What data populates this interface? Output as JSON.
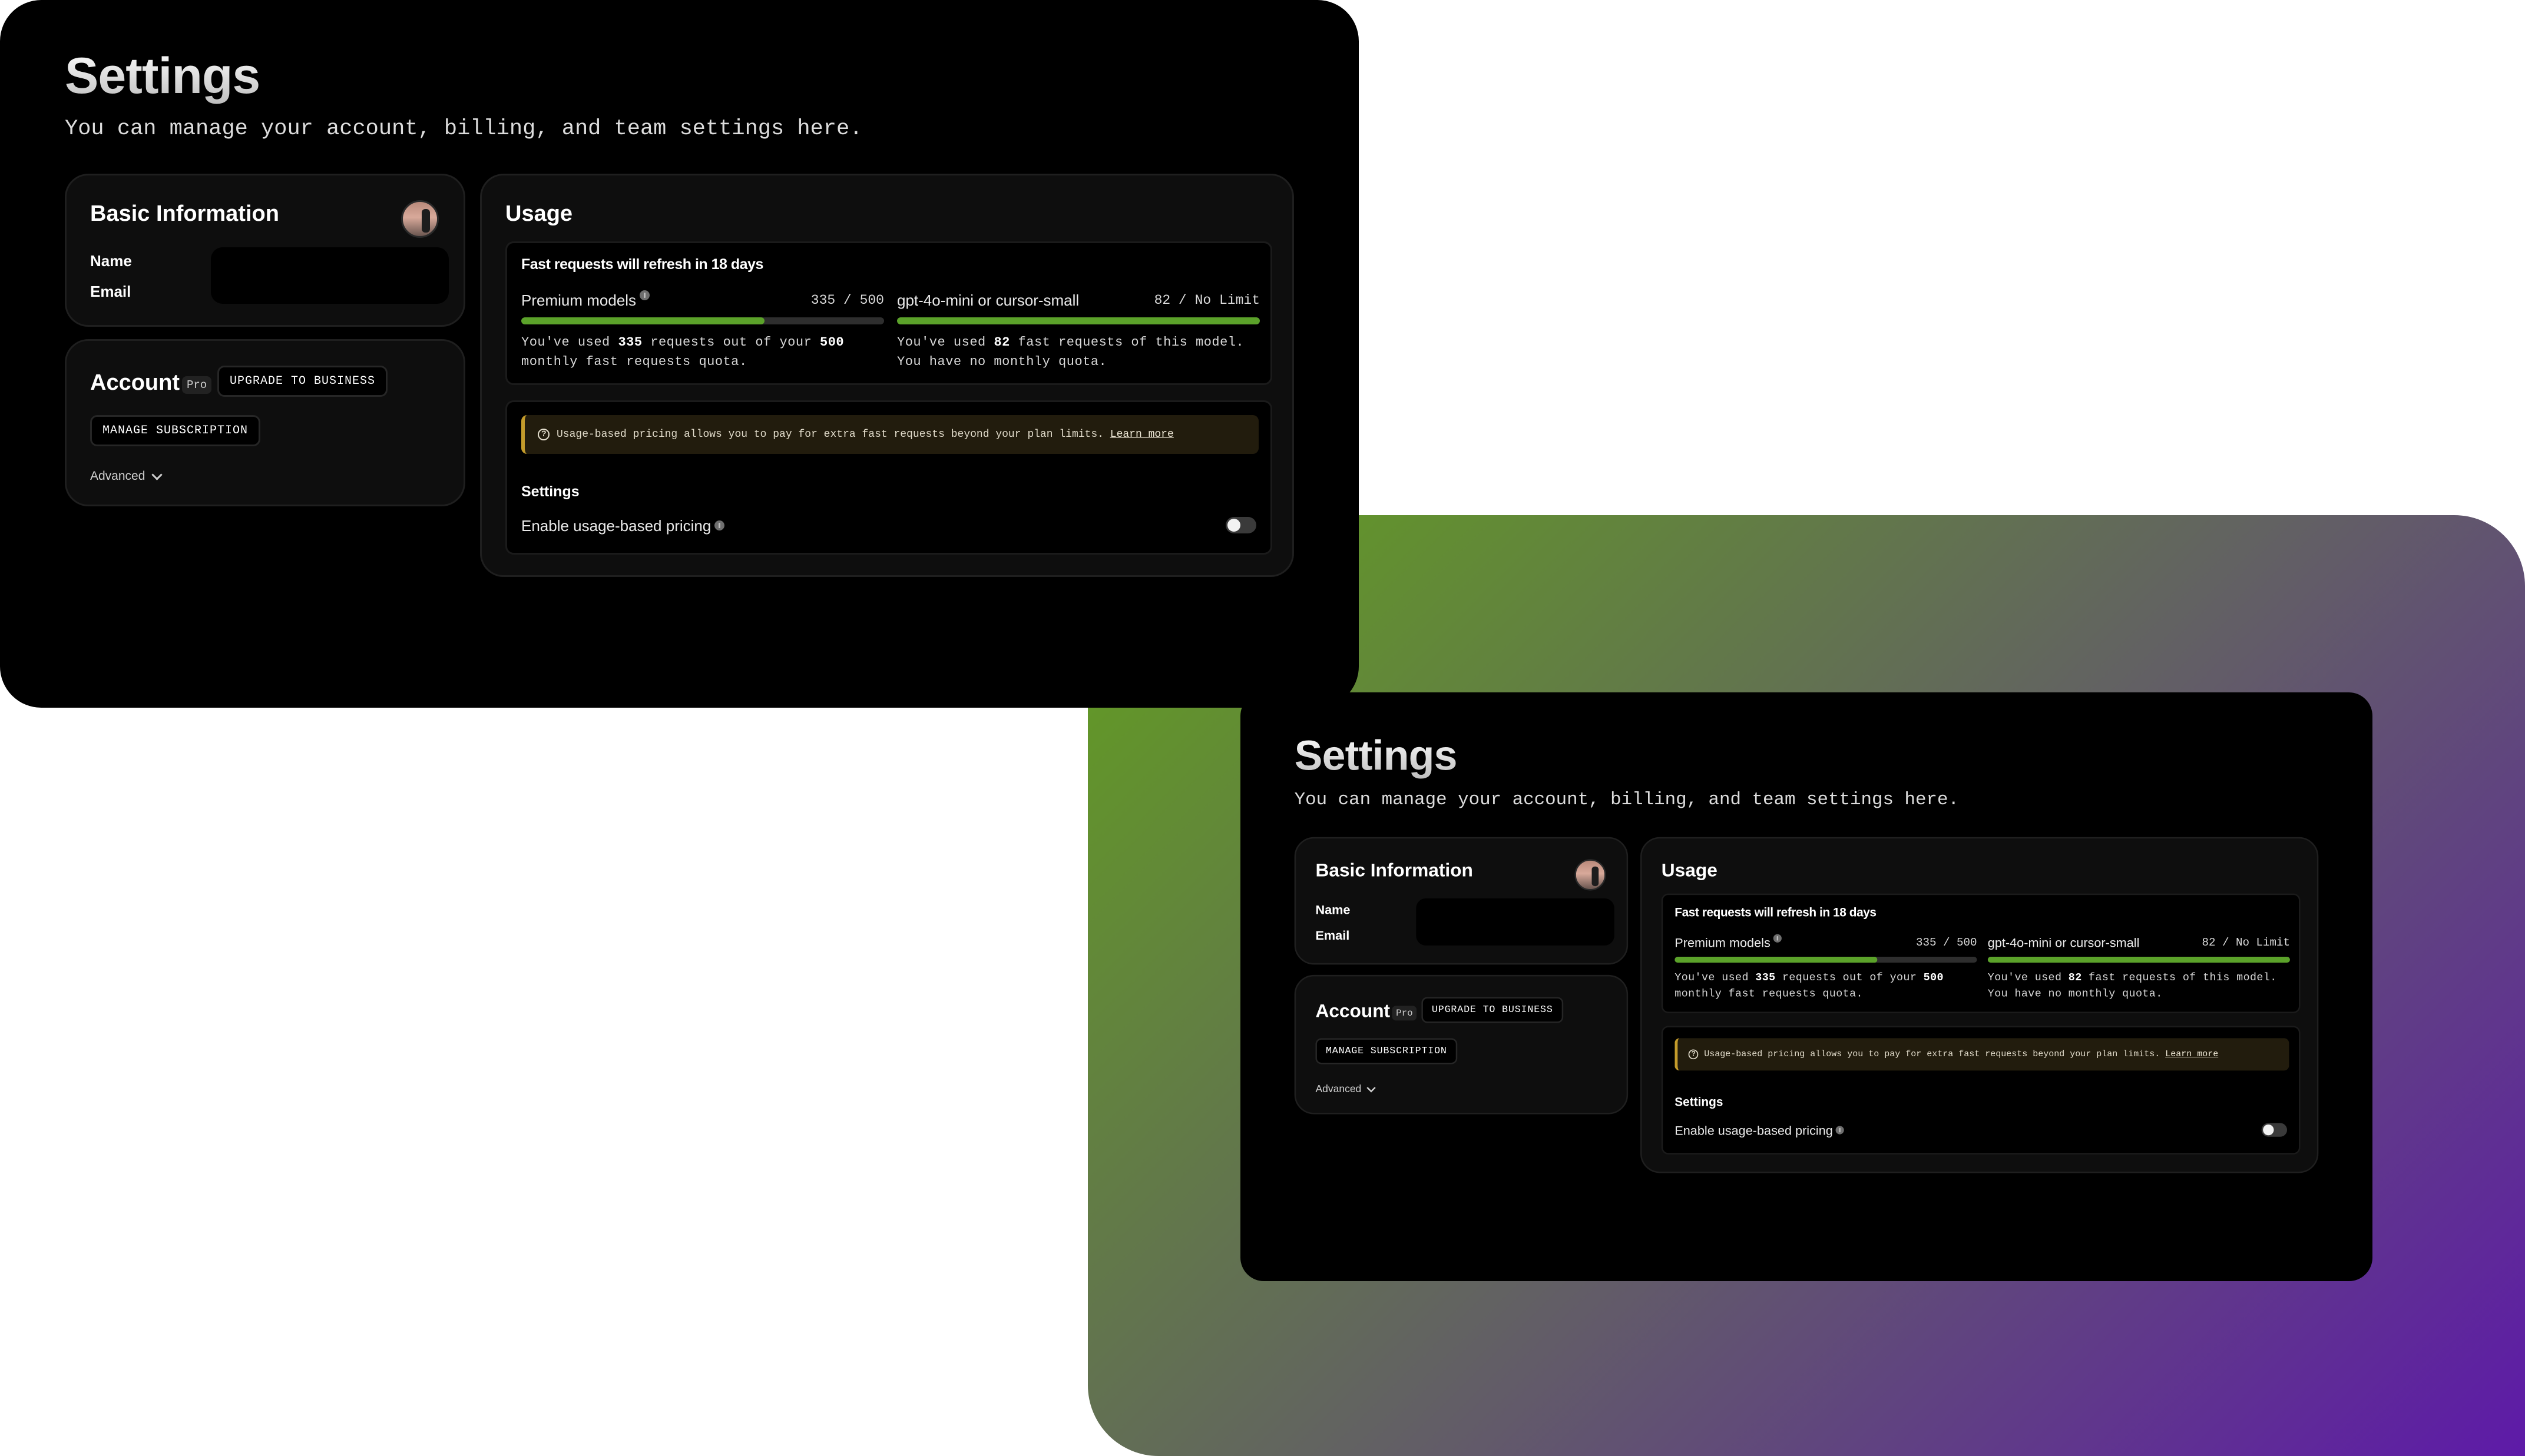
{
  "colors": {
    "accent_green": "#5ba22a",
    "gradient_start": "#62a01e",
    "gradient_end": "#5e1aa8",
    "notice_border": "#c39b2b"
  },
  "settings_page": {
    "title": "Settings",
    "subtitle": "You can manage your account, billing, and team settings here.",
    "basic_info": {
      "title": "Basic Information",
      "name_label": "Name",
      "email_label": "Email"
    },
    "account": {
      "title": "Account",
      "plan_badge": "Pro",
      "upgrade_button": "UPGRADE TO BUSINESS",
      "manage_button": "MANAGE SUBSCRIPTION",
      "advanced_label": "Advanced"
    },
    "usage": {
      "title": "Usage",
      "refresh_note": "Fast requests will refresh in 18 days",
      "premium": {
        "label": "Premium models",
        "value": "335 / 500",
        "used_fraction": 0.67,
        "desc_pre": "You've used ",
        "used": "335",
        "desc_mid": " requests out of your ",
        "quota": "500",
        "desc_post": " monthly fast requests quota."
      },
      "small": {
        "label": "gpt-4o-mini or cursor-small",
        "value": "82 / No Limit",
        "used_fraction": 1.0,
        "desc_pre": "You've used ",
        "used": "82",
        "desc_post": " fast requests of this model. You have no monthly quota."
      },
      "pricing_notice": "Usage-based pricing allows you to pay for extra fast requests beyond your plan limits.",
      "learn_more": "Learn more",
      "settings_heading": "Settings",
      "toggle_label": "Enable usage-based pricing",
      "toggle_on": false
    }
  }
}
